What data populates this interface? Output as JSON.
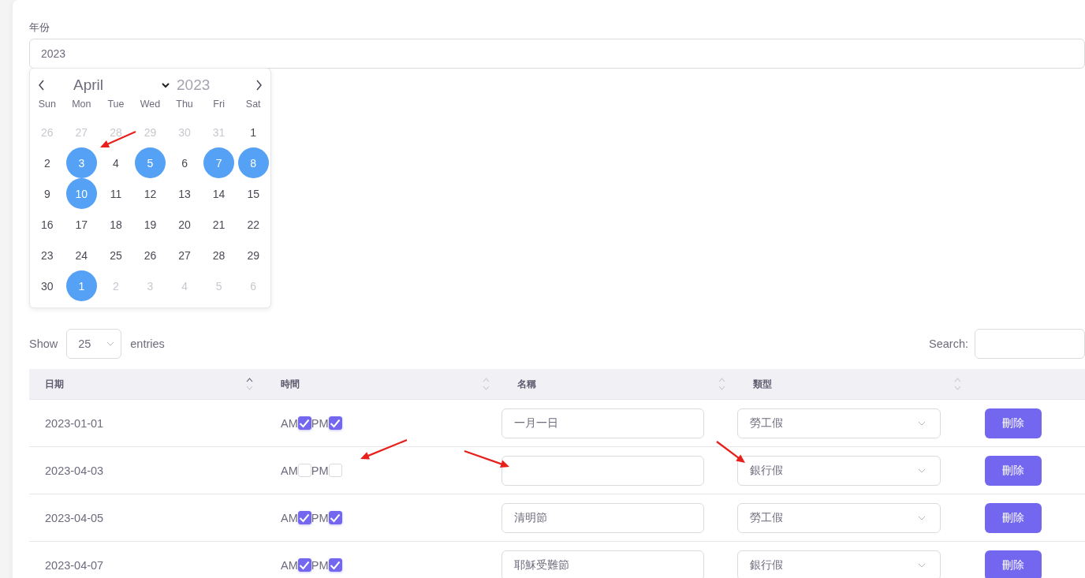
{
  "year_field": {
    "label": "年份",
    "value": "2023"
  },
  "calendar": {
    "month": "April",
    "year": "2023",
    "weekdays": [
      "Sun",
      "Mon",
      "Tue",
      "Wed",
      "Thu",
      "Fri",
      "Sat"
    ],
    "days": [
      {
        "day": "26",
        "outside": true,
        "selected": false
      },
      {
        "day": "27",
        "outside": true,
        "selected": false
      },
      {
        "day": "28",
        "outside": true,
        "selected": false
      },
      {
        "day": "29",
        "outside": true,
        "selected": false
      },
      {
        "day": "30",
        "outside": true,
        "selected": false
      },
      {
        "day": "31",
        "outside": true,
        "selected": false
      },
      {
        "day": "1",
        "outside": false,
        "selected": false
      },
      {
        "day": "2",
        "outside": false,
        "selected": false
      },
      {
        "day": "3",
        "outside": false,
        "selected": true
      },
      {
        "day": "4",
        "outside": false,
        "selected": false
      },
      {
        "day": "5",
        "outside": false,
        "selected": true
      },
      {
        "day": "6",
        "outside": false,
        "selected": false
      },
      {
        "day": "7",
        "outside": false,
        "selected": true
      },
      {
        "day": "8",
        "outside": false,
        "selected": true
      },
      {
        "day": "9",
        "outside": false,
        "selected": false
      },
      {
        "day": "10",
        "outside": false,
        "selected": true
      },
      {
        "day": "11",
        "outside": false,
        "selected": false
      },
      {
        "day": "12",
        "outside": false,
        "selected": false
      },
      {
        "day": "13",
        "outside": false,
        "selected": false
      },
      {
        "day": "14",
        "outside": false,
        "selected": false
      },
      {
        "day": "15",
        "outside": false,
        "selected": false
      },
      {
        "day": "16",
        "outside": false,
        "selected": false
      },
      {
        "day": "17",
        "outside": false,
        "selected": false
      },
      {
        "day": "18",
        "outside": false,
        "selected": false
      },
      {
        "day": "19",
        "outside": false,
        "selected": false
      },
      {
        "day": "20",
        "outside": false,
        "selected": false
      },
      {
        "day": "21",
        "outside": false,
        "selected": false
      },
      {
        "day": "22",
        "outside": false,
        "selected": false
      },
      {
        "day": "23",
        "outside": false,
        "selected": false
      },
      {
        "day": "24",
        "outside": false,
        "selected": false
      },
      {
        "day": "25",
        "outside": false,
        "selected": false
      },
      {
        "day": "26",
        "outside": false,
        "selected": false
      },
      {
        "day": "27",
        "outside": false,
        "selected": false
      },
      {
        "day": "28",
        "outside": false,
        "selected": false
      },
      {
        "day": "29",
        "outside": false,
        "selected": false
      },
      {
        "day": "30",
        "outside": false,
        "selected": false
      },
      {
        "day": "1",
        "outside": true,
        "selected": true
      },
      {
        "day": "2",
        "outside": true,
        "selected": false
      },
      {
        "day": "3",
        "outside": true,
        "selected": false
      },
      {
        "day": "4",
        "outside": true,
        "selected": false
      },
      {
        "day": "5",
        "outside": true,
        "selected": false
      },
      {
        "day": "6",
        "outside": true,
        "selected": false
      }
    ]
  },
  "table_controls": {
    "show_label": "Show",
    "page_size": "25",
    "entries_label": "entries",
    "search_label": "Search:"
  },
  "table": {
    "columns": [
      {
        "label": "日期",
        "sorted_ascending": true
      },
      {
        "label": "時間",
        "sorted_ascending": false
      },
      {
        "label": "名稱",
        "sorted_ascending": false
      },
      {
        "label": "類型",
        "sorted_ascending": false
      }
    ],
    "rows": [
      {
        "date": "2023-01-01",
        "am_label": "AM",
        "am_checked": true,
        "pm_label": "PM",
        "pm_checked": true,
        "name": "一月一日",
        "type": "勞工假",
        "action": "刪除"
      },
      {
        "date": "2023-04-03",
        "am_label": "AM",
        "am_checked": false,
        "pm_label": "PM",
        "pm_checked": false,
        "type": "銀行假",
        "action": "刪除"
      },
      {
        "date": "2023-04-05",
        "am_label": "AM",
        "am_checked": true,
        "pm_label": "PM",
        "pm_checked": true,
        "name": "清明節",
        "type": "勞工假",
        "action": "刪除"
      },
      {
        "date": "2023-04-07",
        "am_label": "AM",
        "am_checked": true,
        "pm_label": "PM",
        "pm_checked": true,
        "name": "耶穌受難節",
        "type": "銀行假",
        "action": "刪除"
      }
    ]
  }
}
